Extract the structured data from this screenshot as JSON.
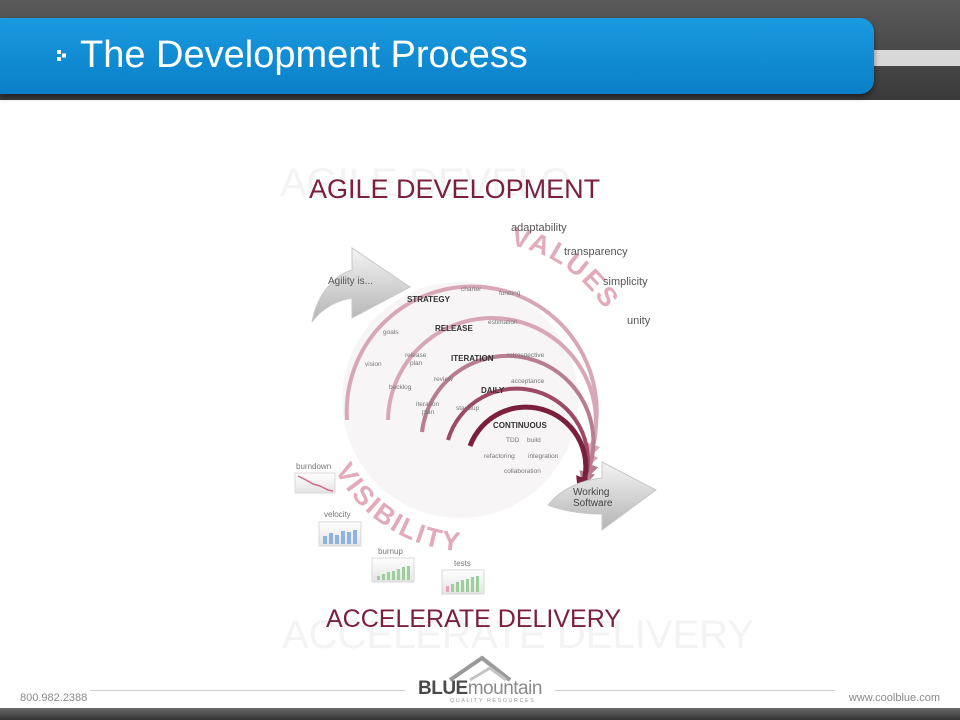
{
  "header": {
    "title": "The Development Process"
  },
  "diagram": {
    "heading": "AGILE DEVELOPMENT",
    "heading_ghost": "AGILE DEVELO",
    "footer_heading": "ACCELERATE DELIVERY",
    "arrow_in_label": "Agility is...",
    "arrow_out_label_line1": "Working",
    "arrow_out_label_line2": "Software",
    "values_word": "VALUES",
    "visibility_word": "VISIBILITY",
    "values": [
      "adaptability",
      "transparency",
      "simplicity",
      "unity"
    ],
    "levels": {
      "strategy": "STRATEGY",
      "release": "RELEASE",
      "iteration": "ITERATION",
      "daily": "DAILY",
      "continuous": "CONTINUOUS"
    },
    "activities": {
      "charter": "charter",
      "funding": "funding",
      "goals": "goals",
      "estimation": "estimation",
      "vision": "vision",
      "release_plan_1": "release",
      "release_plan_2": "plan",
      "retrospective": "retrospective",
      "review": "review",
      "acceptance": "acceptance",
      "backlog": "backlog",
      "iteration_plan_1": "iteration",
      "iteration_plan_2": "plan",
      "standup": "standup",
      "tdd": "TDD",
      "build": "build",
      "refactoring": "refactoring",
      "integration": "integration",
      "collaboration": "collaboration"
    },
    "charts": {
      "burndown": "burndown",
      "velocity": "velocity",
      "burnup": "burnup",
      "tests": "tests"
    },
    "colors": {
      "maroon": "#7a1f3c",
      "pink": "#d8a7b6"
    }
  },
  "footer": {
    "phone": "800.982.2388",
    "logo_blue": "BLUE",
    "logo_mountain": "mountain",
    "logo_tagline": "QUALITY RESOURCES",
    "url": "www.coolblue.com"
  }
}
